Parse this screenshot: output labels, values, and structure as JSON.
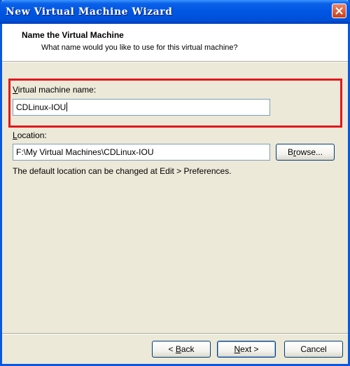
{
  "window": {
    "title": "New Virtual Machine Wizard"
  },
  "header": {
    "title": "Name the Virtual Machine",
    "subtitle": "What name would you like to use for this virtual machine?"
  },
  "form": {
    "vm_name": {
      "label_accel": "V",
      "label_rest": "irtual machine name:",
      "value": "CDLinux-IOU"
    },
    "location": {
      "label_accel": "L",
      "label_rest": "ocation:",
      "value": "F:\\My Virtual Machines\\CDLinux-IOU",
      "browse_accel": "r",
      "browse_pre": "B",
      "browse_post": "owse..."
    },
    "hint": "The default location can be changed at Edit > Preferences."
  },
  "footer": {
    "back_pre": "< ",
    "back_accel": "B",
    "back_post": "ack",
    "next_accel": "N",
    "next_post": "ext >",
    "cancel_label": "Cancel"
  },
  "colors": {
    "titlebar": "#0055e3",
    "highlight": "#e3171c",
    "dialog_bg": "#ece9d8"
  },
  "icons": {
    "close": "close-icon"
  }
}
